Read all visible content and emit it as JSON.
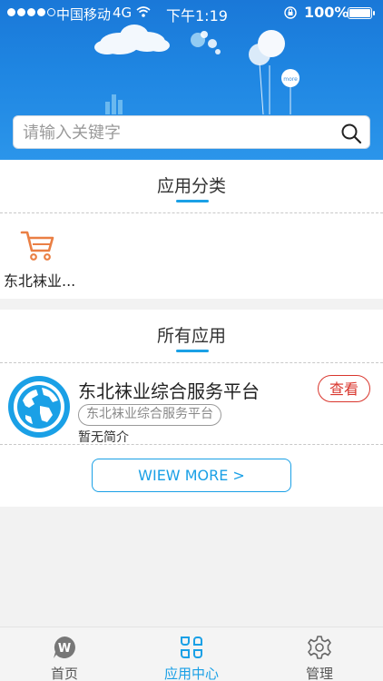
{
  "status_bar": {
    "carrier": "中国移动",
    "network": "4G",
    "time": "下午1:19",
    "battery": "100%",
    "signal_bars": 4
  },
  "banner": {
    "balloon_text": "more"
  },
  "search": {
    "placeholder": "请输入关键字",
    "value": ""
  },
  "categories": {
    "title": "应用分类",
    "items": [
      {
        "label": "东北袜业...",
        "icon": "cart-icon"
      }
    ]
  },
  "all_apps": {
    "title": "所有应用",
    "apps": [
      {
        "name": "东北袜业综合服务平台",
        "tag": "东北袜业综合服务平台",
        "description": "暂无简介",
        "action": "查看",
        "icon": "globe-icon"
      }
    ],
    "more_label": "WIEW MORE >"
  },
  "tabbar": {
    "tabs": [
      {
        "label": "首页",
        "icon": "home-w-icon",
        "active": false
      },
      {
        "label": "应用中心",
        "icon": "grid-icon",
        "active": true
      },
      {
        "label": "管理",
        "icon": "gear-icon",
        "active": false
      }
    ]
  },
  "colors": {
    "accent": "#1aa0e6",
    "action_red": "#d9362d",
    "banner_blue": "#1f86e2",
    "cart_orange": "#ea7f44"
  }
}
